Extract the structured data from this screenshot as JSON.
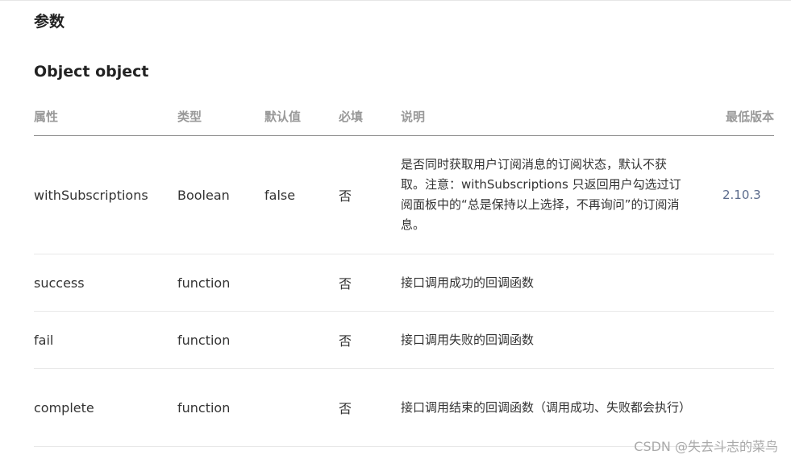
{
  "section_title": "参数",
  "object_title": "Object object",
  "table": {
    "headers": [
      "属性",
      "类型",
      "默认值",
      "必填",
      "说明",
      "最低版本"
    ],
    "rows": [
      {
        "name": "withSubscriptions",
        "type": "Boolean",
        "default": "false",
        "required": "否",
        "description": "是否同时获取用户订阅消息的订阅状态，默认不获取。注意：withSubscriptions 只返回用户勾选过订阅面板中的“总是保持以上选择，不再询问”的订阅消息。",
        "version": "2.10.3"
      },
      {
        "name": "success",
        "type": "function",
        "default": "",
        "required": "否",
        "description": "接口调用成功的回调函数",
        "version": ""
      },
      {
        "name": "fail",
        "type": "function",
        "default": "",
        "required": "否",
        "description": "接口调用失败的回调函数",
        "version": ""
      },
      {
        "name": "complete",
        "type": "function",
        "default": "",
        "required": "否",
        "description": "接口调用结束的回调函数（调用成功、失败都会执行）",
        "version": ""
      }
    ]
  },
  "watermark": "CSDN @失去斗志的菜鸟"
}
